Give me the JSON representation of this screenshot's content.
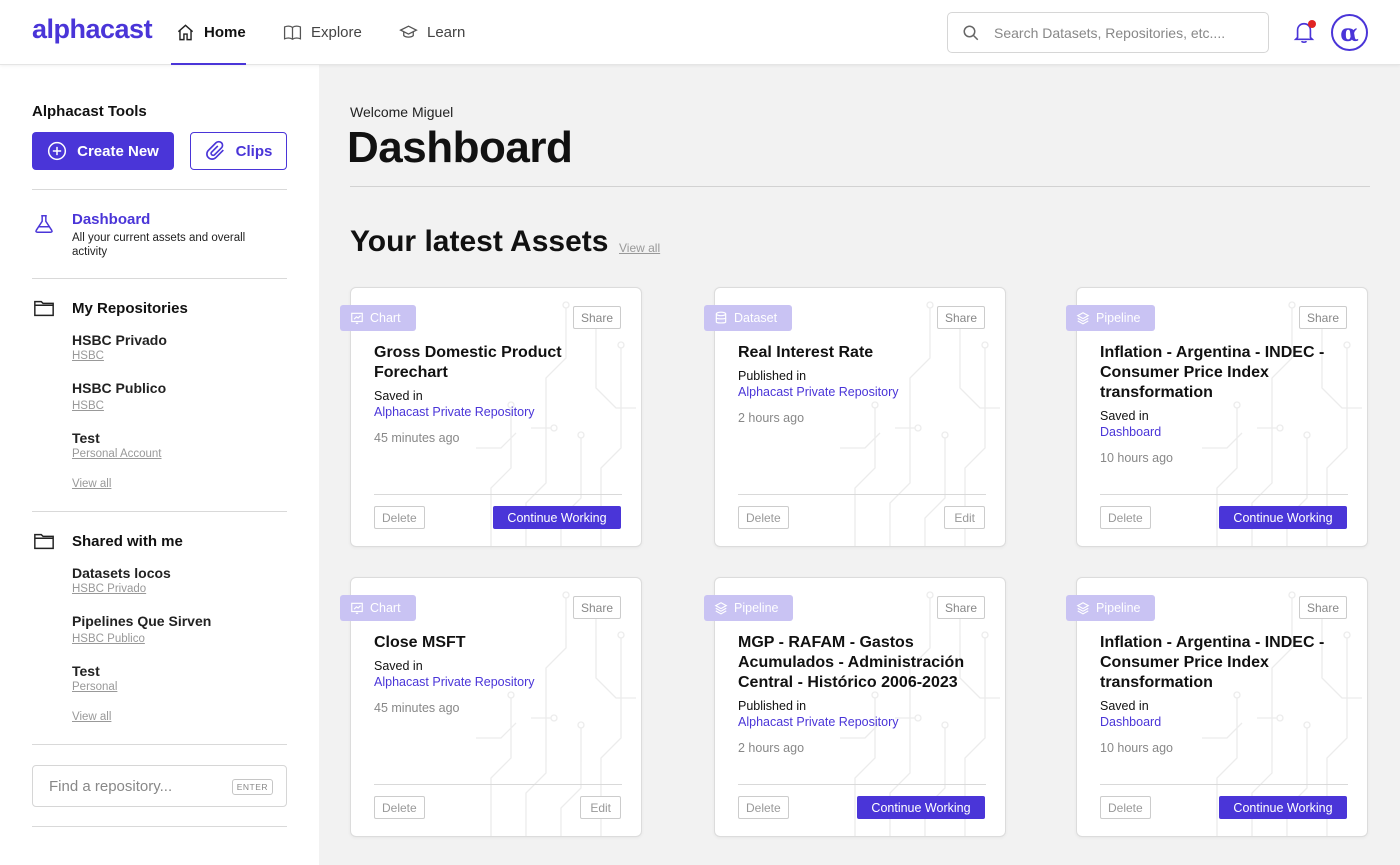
{
  "header": {
    "logo": "alphacast",
    "nav": [
      {
        "label": "Home",
        "icon": "home-icon",
        "active": true
      },
      {
        "label": "Explore",
        "icon": "book-icon",
        "active": false
      },
      {
        "label": "Learn",
        "icon": "graduation-cap-icon",
        "active": false
      }
    ],
    "search_placeholder": "Search Datasets, Repositories, etc....",
    "avatar_glyph": "α",
    "notification_dot": true
  },
  "sidebar": {
    "title": "Alphacast Tools",
    "create_label": "Create New",
    "clips_label": "Clips",
    "dashboard": {
      "label": "Dashboard",
      "desc": "All your current assets and overall activity"
    },
    "my_repos": {
      "label": "My Repositories",
      "items": [
        {
          "name": "HSBC Privado",
          "sub": "HSBC"
        },
        {
          "name": "HSBC Publico",
          "sub": "HSBC"
        },
        {
          "name": "Test",
          "sub": "Personal Account"
        }
      ],
      "view_all": "View all"
    },
    "shared": {
      "label": "Shared with me",
      "items": [
        {
          "name": "Datasets locos",
          "sub": "HSBC Privado"
        },
        {
          "name": "Pipelines Que Sirven",
          "sub": "HSBC Publico"
        },
        {
          "name": "Test",
          "sub": "Personal"
        }
      ],
      "view_all": "View all"
    },
    "find_placeholder": "Find a repository...",
    "enter_key": "ENTER"
  },
  "main": {
    "welcome": "Welcome Miguel",
    "title": "Dashboard",
    "assets_title": "Your latest Assets",
    "view_all": "View all",
    "cards": [
      {
        "type": "Chart",
        "share": "Share",
        "title": "Gross Domestic Product Forechart",
        "saved_label": "Saved in",
        "location": "Alphacast Private Repository",
        "time": "45 minutes ago",
        "delete": "Delete",
        "action": "Continue Working"
      },
      {
        "type": "Dataset",
        "share": "Share",
        "title": "Real Interest Rate",
        "saved_label": "Published in",
        "location": "Alphacast Private Repository",
        "time": "2 hours ago",
        "delete": "Delete",
        "action": "Edit"
      },
      {
        "type": "Pipeline",
        "share": "Share",
        "title": "Inflation - Argentina - INDEC - Consumer Price Index transformation",
        "saved_label": "Saved in",
        "location": "Dashboard",
        "time": "10 hours ago",
        "delete": "Delete",
        "action": "Continue Working"
      },
      {
        "type": "Chart",
        "share": "Share",
        "title": "Close MSFT",
        "saved_label": "Saved in",
        "location": "Alphacast Private Repository",
        "time": "45 minutes ago",
        "delete": "Delete",
        "action": "Edit"
      },
      {
        "type": "Pipeline",
        "share": "Share",
        "title": "MGP - RAFAM - Gastos Acumulados - Administración Central - Histórico 2006-2023",
        "saved_label": "Published in",
        "location": "Alphacast Private Repository",
        "time": "2 hours ago",
        "delete": "Delete",
        "action": "Continue Working"
      },
      {
        "type": "Pipeline",
        "share": "Share",
        "title": "Inflation - Argentina - INDEC - Consumer Price Index transformation",
        "saved_label": "Saved in",
        "location": "Dashboard",
        "time": "10 hours ago",
        "delete": "Delete",
        "action": "Continue Working"
      }
    ]
  },
  "colors": {
    "accent": "#4a35d8",
    "badge": "#c9c3f3",
    "main_bg": "#f2f2f2",
    "notification": "#e02424"
  }
}
